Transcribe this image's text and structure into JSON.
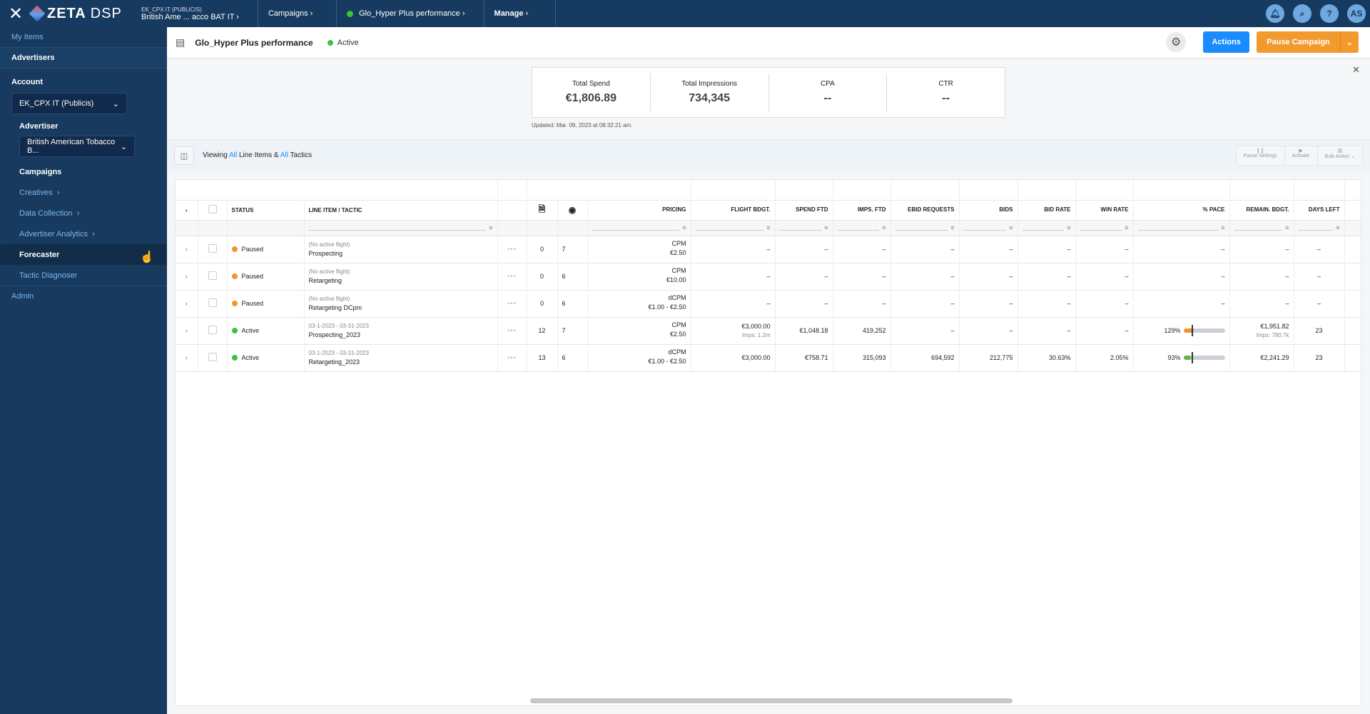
{
  "topbar": {
    "logo": "ZETA DSP",
    "logo_main": "ZETA",
    "logo_sub": "DSP",
    "breadcrumbs": [
      {
        "small": "EK_CPX IT (PUBLICIS)",
        "label": "British Ame ... acco BAT IT"
      },
      {
        "label": "Campaigns"
      },
      {
        "label": "Glo_Hyper Plus performance",
        "status": "active"
      },
      {
        "label": "Manage"
      }
    ],
    "icons": [
      "bell-icon",
      "search-icon",
      "help-icon"
    ],
    "help": "?",
    "avatar": "AS"
  },
  "sidebar": {
    "my_items": "My Items",
    "advertisers": "Advertisers",
    "account_label": "Account",
    "account_value": "EK_CPX IT (Publicis)",
    "advertiser_label": "Advertiser",
    "advertiser_value": "British American Tobacco B...",
    "items": [
      {
        "label": "Campaigns"
      },
      {
        "label": "Creatives",
        "chevron": true
      },
      {
        "label": "Data Collection",
        "chevron": true
      },
      {
        "label": "Advertiser Analytics",
        "chevron": true
      },
      {
        "label": "Forecaster",
        "selected": true
      },
      {
        "label": "Tactic Diagnoser"
      }
    ],
    "admin": "Admin"
  },
  "header": {
    "title": "Glo_Hyper Plus performance",
    "status": "Active",
    "actions_label": "Actions",
    "pause_label": "Pause Campaign"
  },
  "summary": {
    "metrics": [
      {
        "label": "Total Spend",
        "value": "€1,806.89"
      },
      {
        "label": "Total Impressions",
        "value": "734,345"
      },
      {
        "label": "CPA",
        "value": "--"
      },
      {
        "label": "CTR",
        "value": "--"
      }
    ],
    "updated": "Updated: Mar. 09, 2023 at 08:32:21 am."
  },
  "toolbar": {
    "viewing_prefix": "Viewing ",
    "all1": "All",
    "mid": " Line Items & ",
    "all2": "All",
    "suffix": " Tactics",
    "pause_settings": "Pause Settings",
    "activate": "Activate",
    "bulk_action": "Bulk Action"
  },
  "table": {
    "columns": [
      "STATUS",
      "LINE ITEM / TACTIC",
      "PRICING",
      "FLIGHT BDGT.",
      "SPEND FTD",
      "IMPS. FTD",
      "EBID REQUESTS",
      "BIDS",
      "BID RATE",
      "WIN RATE",
      "% PACE",
      "REMAIN. BDGT.",
      "DAYS LEFT"
    ],
    "colors": {
      "paused": "#f0952f",
      "active": "#3fc03f"
    },
    "rows": [
      {
        "status": "Paused",
        "flight": "(No active flight)",
        "name": "Prospecting",
        "creatives": "0",
        "tactics": "7",
        "pricing_type": "CPM",
        "pricing": "€2.50",
        "flight_bdgt": "–",
        "flight_imps": "",
        "spend": "–",
        "imps": "–",
        "ebid": "–",
        "bids": "–",
        "bid_rate": "–",
        "win_rate": "–",
        "pace": "–",
        "pace_value": null,
        "remain": "–",
        "remain_imps": "",
        "days": "–"
      },
      {
        "status": "Paused",
        "flight": "(No active flight)",
        "name": "Retargeting",
        "creatives": "0",
        "tactics": "6",
        "pricing_type": "CPM",
        "pricing": "€10.00",
        "flight_bdgt": "–",
        "flight_imps": "",
        "spend": "–",
        "imps": "–",
        "ebid": "–",
        "bids": "–",
        "bid_rate": "–",
        "win_rate": "–",
        "pace": "–",
        "pace_value": null,
        "remain": "–",
        "remain_imps": "",
        "days": "–"
      },
      {
        "status": "Paused",
        "flight": "(No active flight)",
        "name": "Retargeting DCpm",
        "creatives": "0",
        "tactics": "6",
        "pricing_type": "dCPM",
        "pricing": "€1.00 - €2.50",
        "flight_bdgt": "–",
        "flight_imps": "",
        "spend": "–",
        "imps": "–",
        "ebid": "–",
        "bids": "–",
        "bid_rate": "–",
        "win_rate": "–",
        "pace": "–",
        "pace_value": null,
        "remain": "–",
        "remain_imps": "",
        "days": "–"
      },
      {
        "status": "Active",
        "flight": "03-1-2023 - 03-31-2023",
        "name": "Prospecting_2023",
        "creatives": "12",
        "tactics": "7",
        "pricing_type": "CPM",
        "pricing": "€2.50",
        "flight_bdgt": "€3,000.00",
        "flight_imps": "Imps: 1.2m",
        "spend": "€1,048.18",
        "imps": "419,252",
        "ebid": "–",
        "bids": "–",
        "bid_rate": "–",
        "win_rate": "–",
        "pace": "129%",
        "pace_value": 129,
        "pace_color": "#f0952f",
        "remain": "€1,951.82",
        "remain_imps": "Imps: 780.7k",
        "days": "23"
      },
      {
        "status": "Active",
        "flight": "03-1-2023 - 03-31-2023",
        "name": "Retargeting_2023",
        "creatives": "13",
        "tactics": "6",
        "pricing_type": "dCPM",
        "pricing": "€1.00 - €2.50",
        "flight_bdgt": "€3,000.00",
        "flight_imps": "",
        "spend": "€758.71",
        "imps": "315,093",
        "ebid": "694,592",
        "bids": "212,775",
        "bid_rate": "30.63%",
        "win_rate": "2.05%",
        "pace": "93%",
        "pace_value": 93,
        "pace_color": "#6ab04c",
        "remain": "€2,241.29",
        "remain_imps": "",
        "days": "23"
      }
    ]
  }
}
